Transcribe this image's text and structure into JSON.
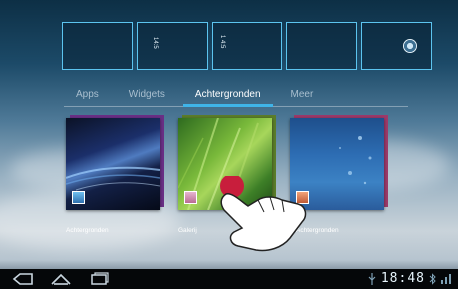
{
  "home_previews": {
    "widget_texts": [
      "14:5",
      "1 4:5"
    ]
  },
  "tabs": [
    {
      "label": "Apps",
      "active": false
    },
    {
      "label": "Widgets",
      "active": false
    },
    {
      "label": "Achtergronden",
      "active": true
    },
    {
      "label": "Meer",
      "active": false
    }
  ],
  "wallpapers": [
    {
      "label": "Achtergronden",
      "icon": "live-wallpaper-icon"
    },
    {
      "label": "Galerij",
      "icon": "gallery-icon"
    },
    {
      "label": "Achtergronden",
      "icon": "wallpaper-icon"
    }
  ],
  "statusbar": {
    "time": "18:48"
  },
  "colors": {
    "accent": "#3fb4e8",
    "preview_border": "#5cc4ef",
    "touch_dot": "#c81e3c"
  },
  "icons": {
    "back": "back-icon",
    "home": "home-icon",
    "recent": "recent-apps-icon",
    "usb": "usb-icon",
    "bluetooth": "bluetooth-icon",
    "signal": "signal-icon"
  }
}
